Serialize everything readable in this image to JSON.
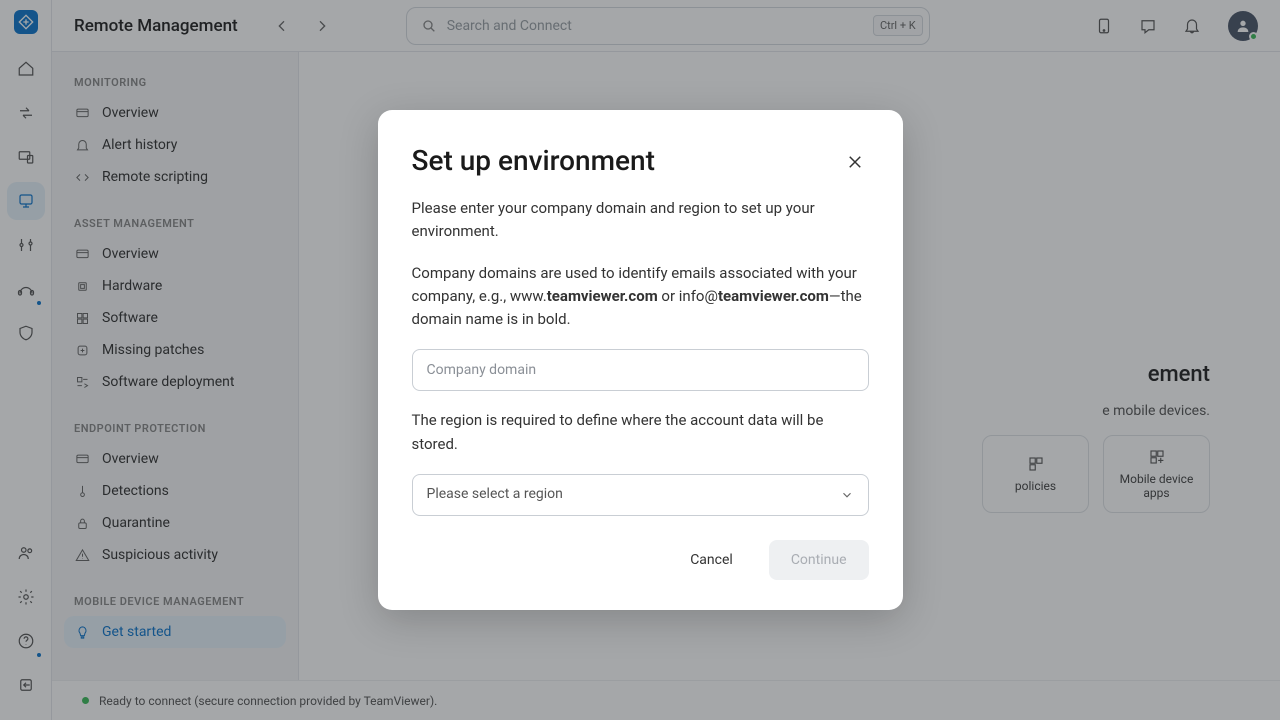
{
  "header": {
    "title": "Remote Management",
    "search_placeholder": "Search and Connect",
    "shortcut": "Ctrl + K"
  },
  "sidebar": {
    "s1": {
      "title": "Monitoring",
      "i0": "Overview",
      "i1": "Alert history",
      "i2": "Remote scripting"
    },
    "s2": {
      "title": "Asset Management",
      "i0": "Overview",
      "i1": "Hardware",
      "i2": "Software",
      "i3": "Missing patches",
      "i4": "Software deployment"
    },
    "s3": {
      "title": "Endpoint Protection",
      "i0": "Overview",
      "i1": "Detections",
      "i2": "Quarantine",
      "i3": "Suspicious activity"
    },
    "s4": {
      "title": "Mobile Device Management",
      "i0": "Get started"
    }
  },
  "background": {
    "title_suffix": "ement",
    "subtitle_suffix": "e mobile devices.",
    "tile1": "policies",
    "tile2": "Mobile device apps"
  },
  "status": {
    "text": "Ready to connect (secure connection provided by TeamViewer)."
  },
  "modal": {
    "title": "Set up environment",
    "para1": "Please enter your company domain and region to set up your environment.",
    "para2_pre": "Company domains are used to identify emails associated with your company, e.g., www.",
    "para2_bold1": "teamviewer.com",
    "para2_mid": " or info@",
    "para2_bold2": "teamviewer.com",
    "para2_post": "—the domain name is in bold.",
    "input_placeholder": "Company domain",
    "para3": "The region is required to define where the account data will be stored.",
    "select_placeholder": "Please select a region",
    "cancel": "Cancel",
    "continue": "Continue"
  }
}
